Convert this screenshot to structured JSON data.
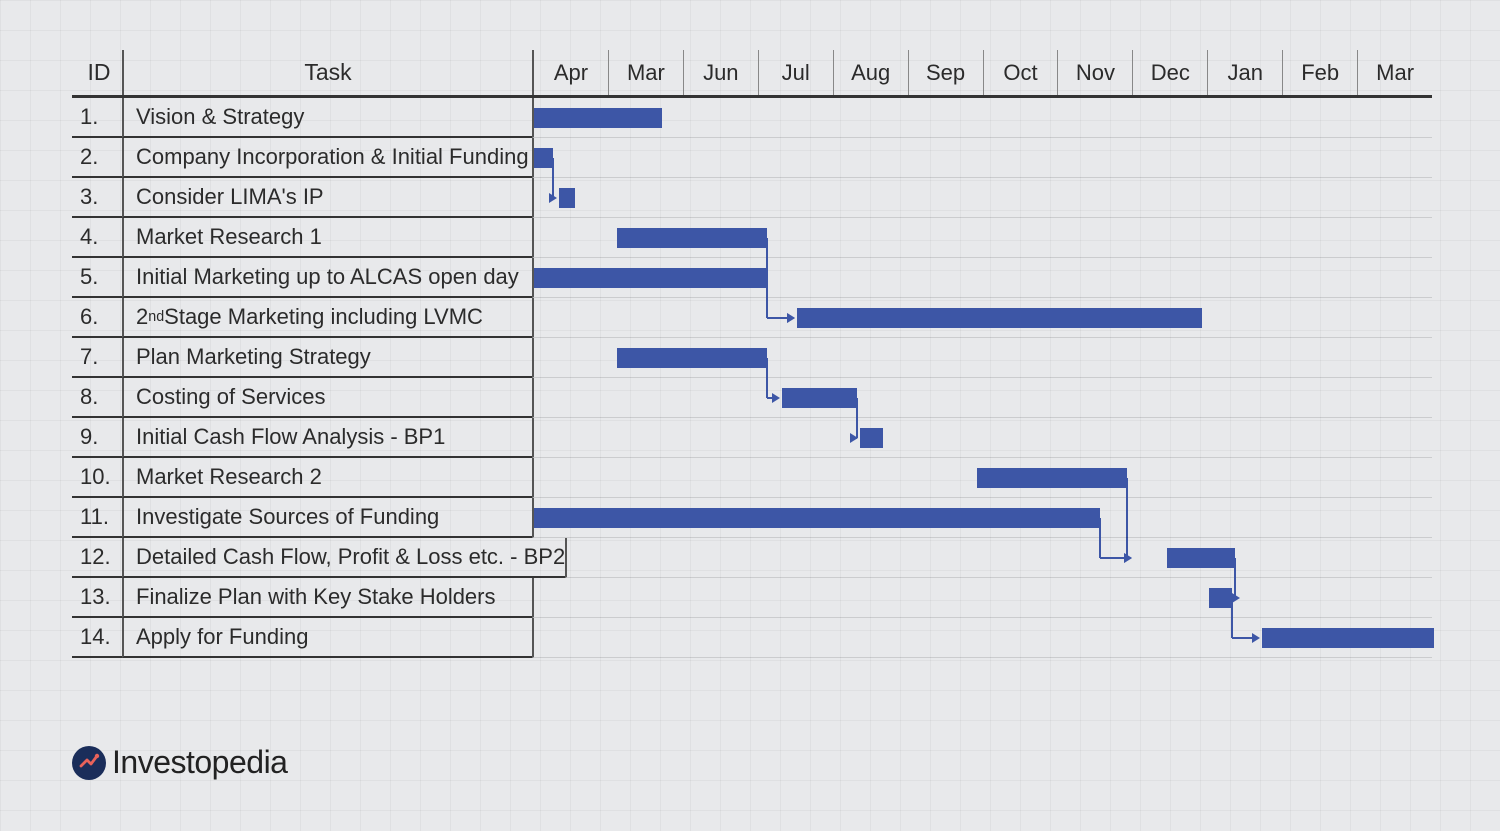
{
  "header": {
    "id_label": "ID",
    "task_label": "Task"
  },
  "months": [
    "Apr",
    "Mar",
    "Jun",
    "Jul",
    "Aug",
    "Sep",
    "Oct",
    "Nov",
    "Dec",
    "Jan",
    "Feb",
    "Mar"
  ],
  "tasks": [
    {
      "id": "1.",
      "name": "Vision & Strategy"
    },
    {
      "id": "2.",
      "name": "Company Incorporation & Initial Funding"
    },
    {
      "id": "3.",
      "name": "Consider LIMA's IP"
    },
    {
      "id": "4.",
      "name": "Market Research 1"
    },
    {
      "id": "5.",
      "name": "Initial Marketing up to ALCAS open day"
    },
    {
      "id": "6.",
      "name": "2nd Stage Marketing including LVMC"
    },
    {
      "id": "7.",
      "name": "Plan Marketing Strategy"
    },
    {
      "id": "8.",
      "name": "Costing of Services"
    },
    {
      "id": "9.",
      "name": "Initial Cash Flow Analysis - BP1"
    },
    {
      "id": "10.",
      "name": "Market Research 2"
    },
    {
      "id": "11.",
      "name": "Investigate Sources of Funding"
    },
    {
      "id": "12.",
      "name": "Detailed Cash Flow, Profit & Loss etc. - BP2"
    },
    {
      "id": "13.",
      "name": "Finalize Plan with Key Stake Holders"
    },
    {
      "id": "14.",
      "name": "Apply for Funding"
    }
  ],
  "brand": "Investopedia",
  "chart_data": {
    "type": "gantt",
    "title": "",
    "x_categories": [
      "Apr",
      "Mar",
      "Jun",
      "Jul",
      "Aug",
      "Sep",
      "Oct",
      "Nov",
      "Dec",
      "Jan",
      "Feb",
      "Mar"
    ],
    "month_units": 12,
    "bars": [
      {
        "task": 1,
        "start": 0.0,
        "end": 1.7
      },
      {
        "task": 2,
        "start": 0.0,
        "end": 0.25
      },
      {
        "task": 3,
        "start": 0.33,
        "end": 0.55
      },
      {
        "task": 4,
        "start": 1.1,
        "end": 3.1
      },
      {
        "task": 5,
        "start": 0.0,
        "end": 3.1
      },
      {
        "task": 6,
        "start": 3.5,
        "end": 8.9
      },
      {
        "task": 7,
        "start": 1.1,
        "end": 3.1
      },
      {
        "task": 8,
        "start": 3.3,
        "end": 4.3
      },
      {
        "task": 9,
        "start": 4.35,
        "end": 4.65
      },
      {
        "task": 10,
        "start": 5.9,
        "end": 7.9
      },
      {
        "task": 11,
        "start": 0.0,
        "end": 7.55
      },
      {
        "task": 12,
        "start": 8.0,
        "end": 8.9
      },
      {
        "task": 13,
        "start": 9.0,
        "end": 9.3
      },
      {
        "task": 14,
        "start": 9.7,
        "end": 12.0
      }
    ],
    "dependencies": [
      {
        "from": 2,
        "to": 3
      },
      {
        "from": 4,
        "to": 6
      },
      {
        "from": 5,
        "to": 6
      },
      {
        "from": 7,
        "to": 8
      },
      {
        "from": 8,
        "to": 9
      },
      {
        "from": 10,
        "to": 12
      },
      {
        "from": 11,
        "to": 12
      },
      {
        "from": 12,
        "to": 13
      },
      {
        "from": 13,
        "to": 14
      }
    ]
  }
}
